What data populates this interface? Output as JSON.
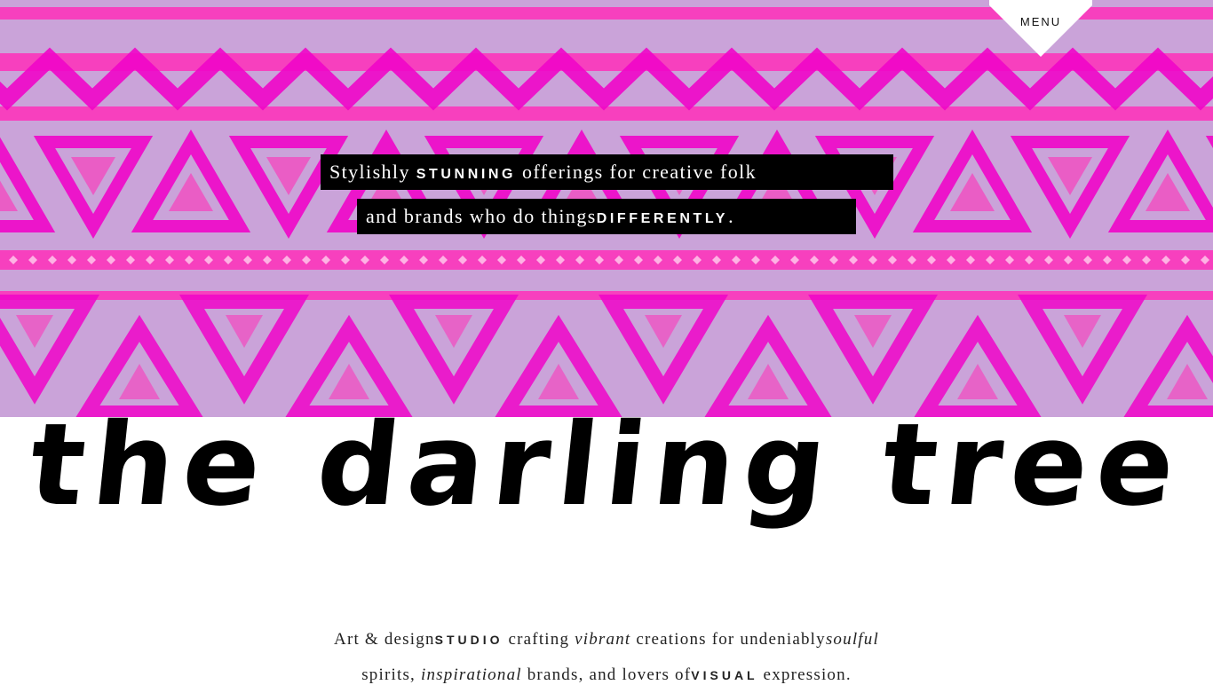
{
  "menu": {
    "label": "MENU"
  },
  "hero": {
    "line1": {
      "pre": "Stylishly ",
      "caps": "STUNNING",
      "post": " offerings for creative folk"
    },
    "line2": {
      "pre": "and brands who do things",
      "caps": "DIFFERENTLY",
      "post": "."
    }
  },
  "logo": {
    "text": "the darling tree"
  },
  "intro": {
    "line1": {
      "a": "Art & design",
      "caps": "STUDIO",
      "b": " crafting ",
      "em1": "vibrant",
      "c": " creations for undeniably",
      "em2": "soulful"
    },
    "line2": {
      "a": "spirits, ",
      "em1": "inspirational",
      "b": " brands, and lovers of",
      "caps": "VISUAL",
      "c": " expression."
    }
  },
  "colors": {
    "pattern_pink": "#ff2fb8",
    "pattern_magenta": "#f005c8",
    "pattern_lavender": "#c8a0d8",
    "tag_background": "#000000",
    "text": "#111111"
  }
}
